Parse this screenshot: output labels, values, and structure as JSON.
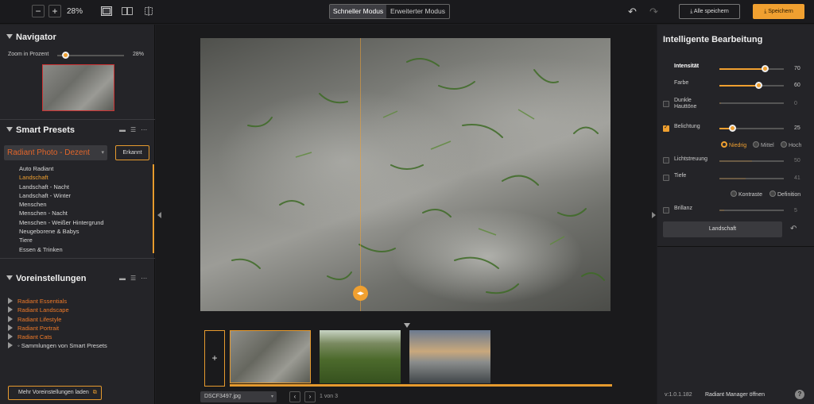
{
  "toolbar": {
    "zoom_minus": "−",
    "zoom_plus": "+",
    "zoom_level": "28%",
    "mode_quick": "Schneller Modus",
    "mode_advanced": "Erweiterter Modus",
    "undo": "↶",
    "redo": "↷",
    "save_all": "⤓ Alle speichern",
    "save": "⤓ Speichern"
  },
  "navigator": {
    "title": "Navigator",
    "zoom_label": "Zoom in Prozent",
    "zoom_value": "28%",
    "zoom_fraction": 0.28
  },
  "smart_presets": {
    "title": "Smart Presets",
    "selected": "Radiant Photo - Dezent",
    "detected_button": "Erkannt",
    "items": [
      "Auto Radiant",
      "Landschaft",
      "Landschaft - Nacht",
      "Landschaft - Winter",
      "Menschen",
      "Menschen - Nacht",
      "Menschen - Weißer Hintergrund",
      "Neugeborene & Babys",
      "Tiere",
      "Essen & Trinken"
    ],
    "selected_index": 1
  },
  "voreinstellungen": {
    "title": "Voreinstellungen",
    "items": [
      "Radiant Essentials",
      "Radiant Landscape",
      "Radiant Lifestyle",
      "Radiant Portrait",
      "Radiant Cats",
      "◦ Sammlungen von Smart Presets"
    ],
    "more_button": "Mehr Voreinstellungen laden"
  },
  "filmstrip": {
    "add": "+",
    "file_name": "DSCF3497.jpg",
    "page_info": "1 von 3",
    "prev": "‹",
    "next": "›"
  },
  "smart_edit": {
    "title": "Intelligente Bearbeitung",
    "intensity_label": "Intensität",
    "intensity_value": "70",
    "color_label": "Farbe",
    "color_value": "60",
    "dark_skin_label": "Dunkle Hauttöne",
    "dark_skin_value": "0",
    "exposure_label": "Belichtung",
    "exposure_value": "25",
    "exposure_options": [
      "Niedrig",
      "Mittel",
      "Hoch"
    ],
    "light_scatter_label": "Lichtstreuung",
    "light_scatter_value": "50",
    "depth_label": "Tiefe",
    "depth_value": "41",
    "depth_options": [
      "Kontraste",
      "Definition"
    ],
    "brilliance_label": "Brillanz",
    "brilliance_value": "5",
    "preset_button": "Landschaft",
    "reset": "↶"
  },
  "footer": {
    "version": "v:1.0.1.182",
    "manager": "Radiant Manager öffnen",
    "help": "?"
  },
  "colors": {
    "accent": "#f0a030",
    "preset_text": "#e2652a"
  }
}
